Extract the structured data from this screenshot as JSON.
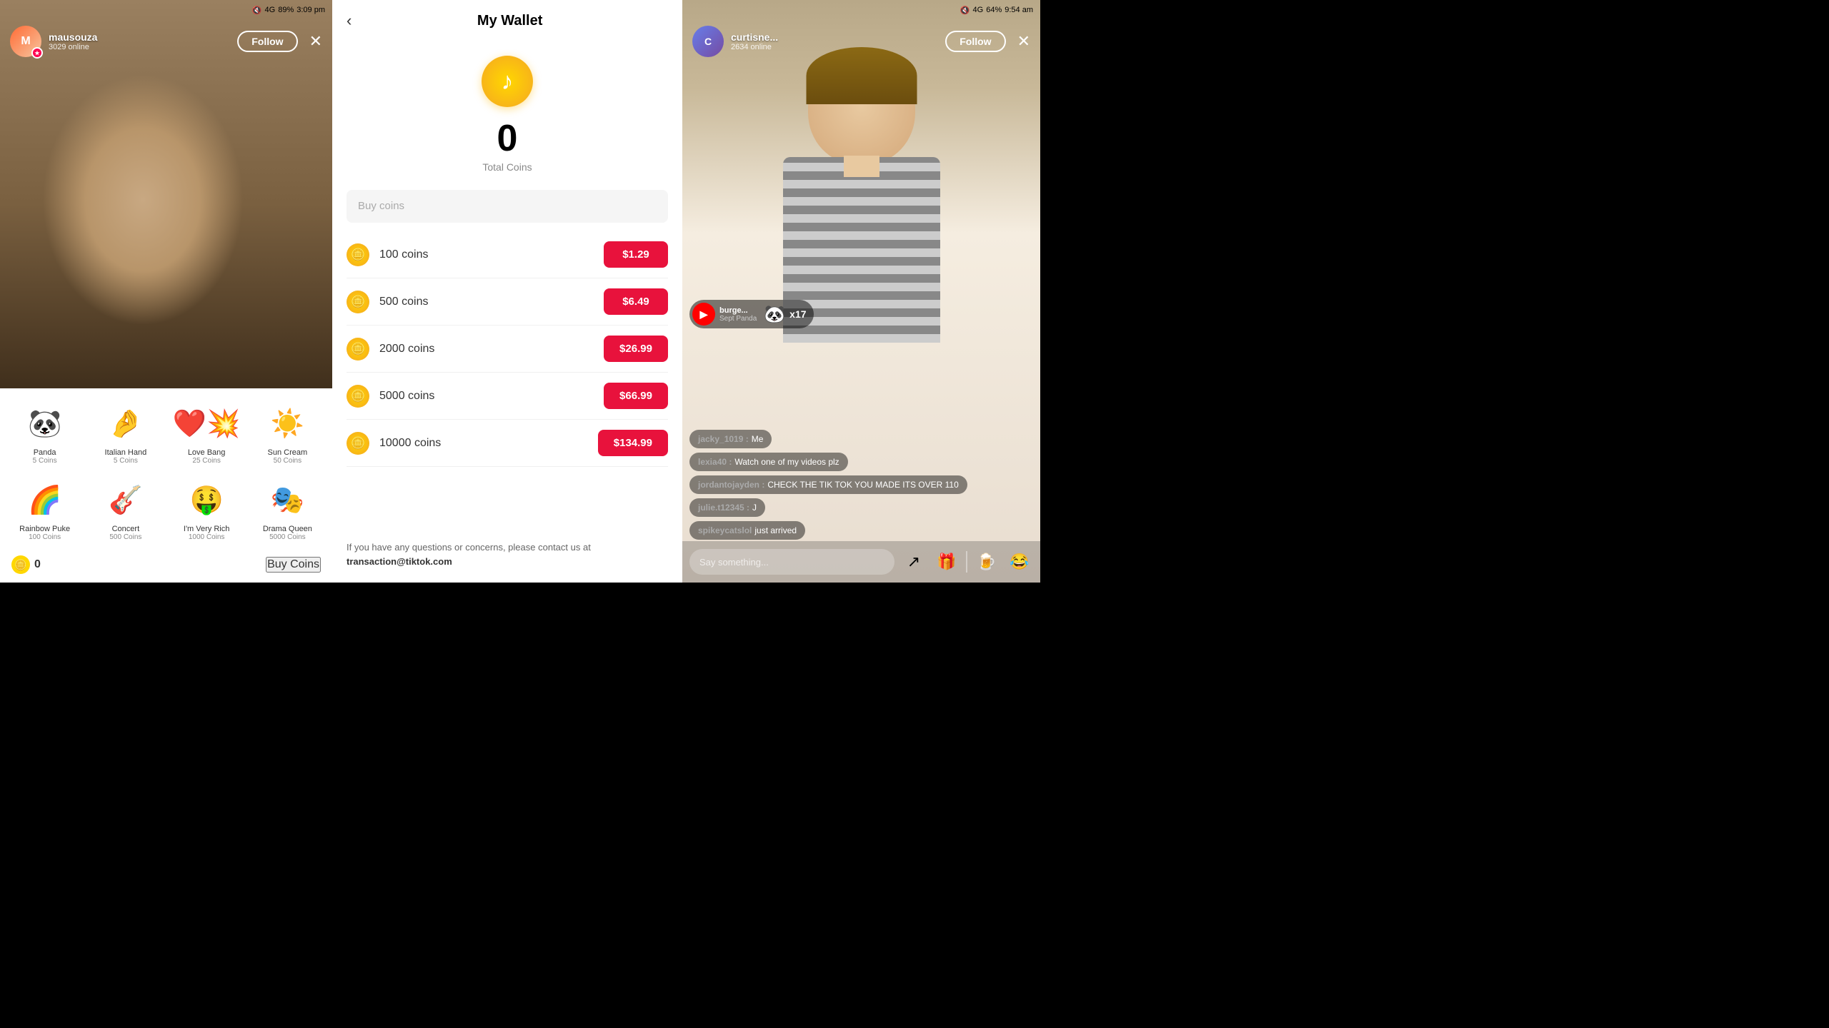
{
  "left": {
    "statusBar": {
      "signal": "4G",
      "battery": "89%",
      "time": "3:09 pm"
    },
    "user": {
      "name": "mausouza",
      "online": "3029 online",
      "followLabel": "Follow"
    },
    "gifts": [
      {
        "id": "panda",
        "emoji": "🐼",
        "name": "Panda",
        "coins": "5 Coins"
      },
      {
        "id": "italian-hand",
        "emoji": "🤌",
        "name": "Italian Hand",
        "coins": "5 Coins"
      },
      {
        "id": "love-bang",
        "emoji": "❤️‍💥",
        "name": "Love Bang",
        "coins": "25 Coins"
      },
      {
        "id": "sun-cream",
        "emoji": "🌞",
        "name": "Sun Cream",
        "coins": "50 Coins"
      },
      {
        "id": "rainbow-puke",
        "emoji": "🌈",
        "name": "Rainbow Puke",
        "coins": "100 Coins"
      },
      {
        "id": "concert",
        "emoji": "🎸",
        "name": "Concert",
        "coins": "500 Coins"
      },
      {
        "id": "im-very-rich",
        "emoji": "🤑",
        "name": "I'm Very Rich",
        "coins": "1000 Coins"
      },
      {
        "id": "drama-queen",
        "emoji": "🎭",
        "name": "Drama Queen",
        "coins": "5000 Coins"
      }
    ],
    "coinAmount": "0",
    "buyCoinsLabel": "Buy Coins"
  },
  "wallet": {
    "title": "My Wallet",
    "totalCoins": "0",
    "totalLabel": "Total Coins",
    "buyCoinsPlaceholder": "Buy coins",
    "coinOptions": [
      {
        "amount": "100 coins",
        "price": "$1.29"
      },
      {
        "amount": "500 coins",
        "price": "$6.49"
      },
      {
        "amount": "2000 coins",
        "price": "$26.99"
      },
      {
        "amount": "5000 coins",
        "price": "$66.99"
      },
      {
        "amount": "10000 coins",
        "price": "$134.99"
      }
    ],
    "contactText": "If you have any questions or concerns, please contact us at",
    "contactEmail": "transaction@tiktok.com"
  },
  "right": {
    "statusBar": {
      "signal": "4G",
      "battery": "64%",
      "time": "9:54 am"
    },
    "user": {
      "name": "curtisne...",
      "online": "2634 online",
      "followLabel": "Follow"
    },
    "giftNotification": {
      "sender": "burge...",
      "giftName": "Sept Panda",
      "count": "x17"
    },
    "comments": [
      {
        "user": "jacky_1019",
        "text": "Me"
      },
      {
        "user": "lexia40",
        "text": "Watch one of my videos plz"
      },
      {
        "user": "jordantojayden",
        "text": "CHECK THE TIK TOK YOU MADE ITS OVER 110"
      },
      {
        "user": "julie.t12345",
        "text": "J"
      },
      {
        "user": "spikeycatslol",
        "text": "just arrived"
      }
    ],
    "commentPlaceholder": "Say something..."
  }
}
